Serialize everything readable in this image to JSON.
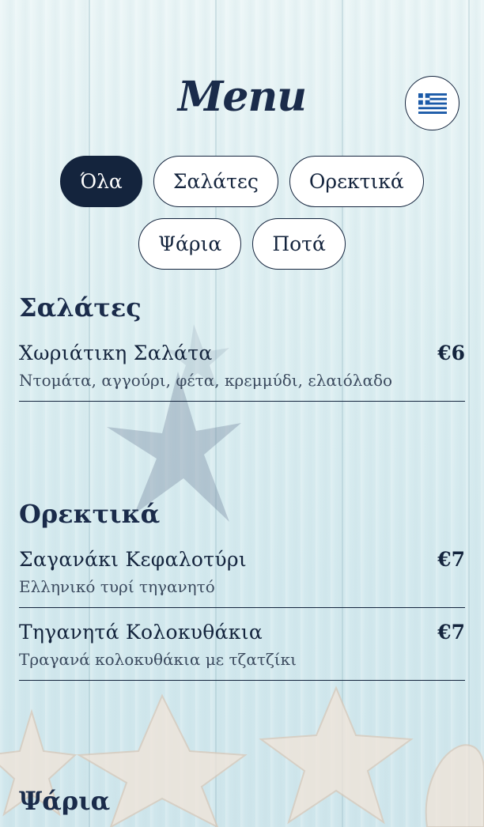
{
  "header": {
    "title": "Menu",
    "language_icon": "greek-flag-icon"
  },
  "filters": [
    {
      "label": "Όλα",
      "active": true
    },
    {
      "label": "Σαλάτες",
      "active": false
    },
    {
      "label": "Ορεκτικά",
      "active": false
    },
    {
      "label": "Ψάρια",
      "active": false
    },
    {
      "label": "Ποτά",
      "active": false
    }
  ],
  "sections": [
    {
      "title": "Σαλάτες",
      "items": [
        {
          "name": "Χωριάτικη Σαλάτα",
          "price": "€6",
          "description": "Ντομάτα, αγγούρι, φέτα, κρεμμύδι, ελαιόλαδο"
        }
      ]
    },
    {
      "title": "Ορεκτικά",
      "items": [
        {
          "name": "Σαγανάκι Κεφαλοτύρι",
          "price": "€7",
          "description": "Ελληνικό τυρί τηγανητό"
        },
        {
          "name": "Τηγανητά Κολοκυθάκια",
          "price": "€7",
          "description": "Τραγανά κολοκυθάκια με τζατζίκι"
        }
      ]
    },
    {
      "title": "Ψάρια",
      "items": []
    }
  ],
  "colors": {
    "navy": "#14243d",
    "background": "#dbecef",
    "white": "#ffffff"
  }
}
